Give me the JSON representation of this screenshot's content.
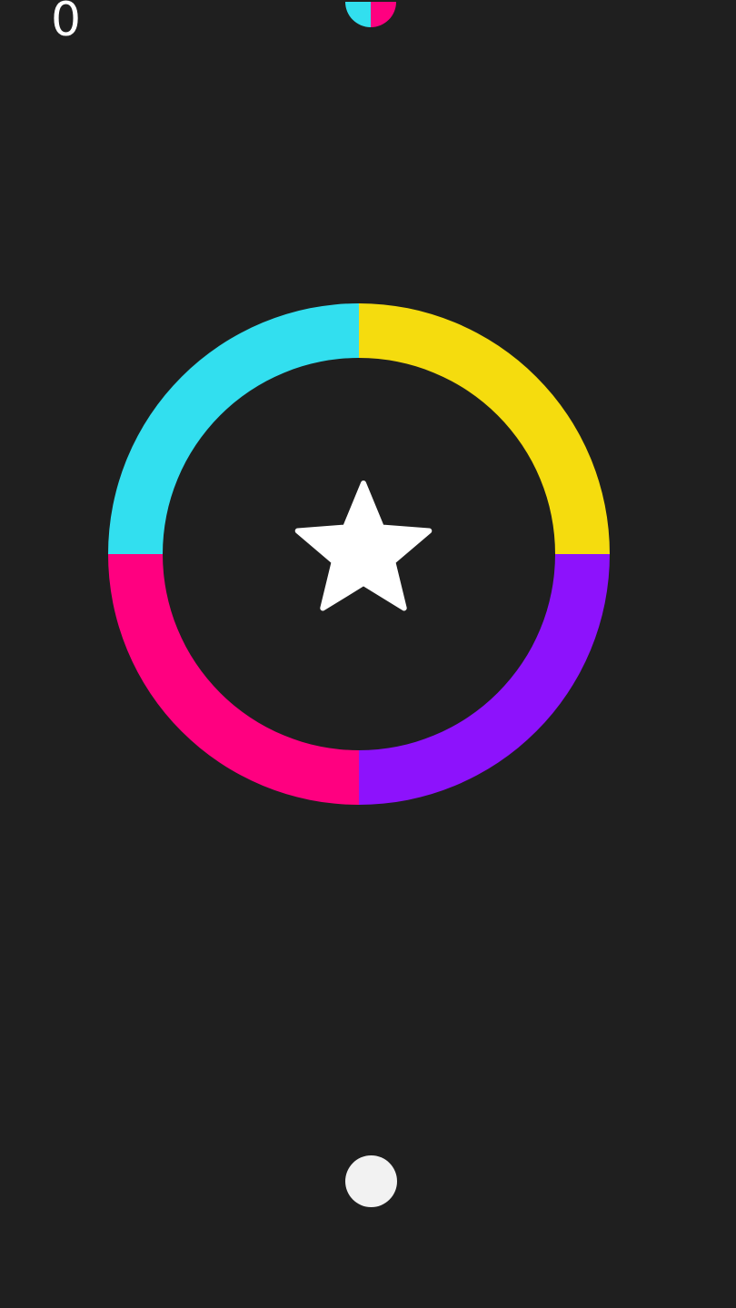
{
  "game": {
    "score": "0"
  },
  "colors": {
    "background": "#1f1f1f",
    "cyan": "#32dfef",
    "yellow": "#f5dc0e",
    "purple": "#8d12fc",
    "magenta": "#ff0080",
    "ball": "#f2f2f2",
    "star": "#ffffff"
  },
  "ring": {
    "segments": [
      {
        "color_key": "yellow",
        "quadrant": "top-right"
      },
      {
        "color_key": "purple",
        "quadrant": "bottom-right"
      },
      {
        "color_key": "magenta",
        "quadrant": "bottom-left"
      },
      {
        "color_key": "cyan",
        "quadrant": "top-left"
      }
    ]
  },
  "icons": {
    "star": "star-icon",
    "color_switcher": "color-switcher-icon",
    "ball": "player-ball"
  }
}
